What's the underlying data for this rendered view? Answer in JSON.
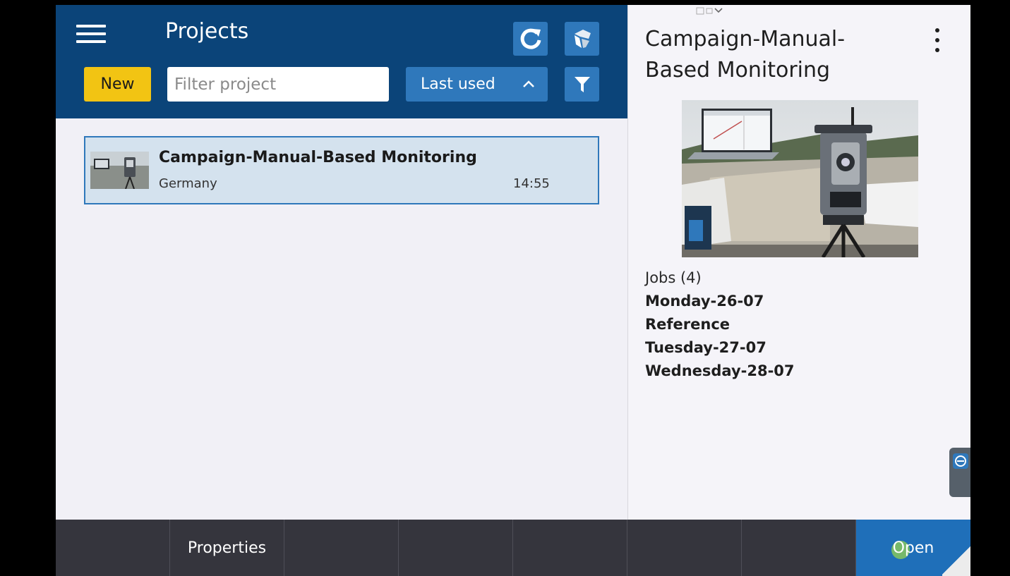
{
  "header": {
    "title": "Projects",
    "new_label": "New",
    "filter_placeholder": "Filter project",
    "sort_label": "Last used"
  },
  "projects": [
    {
      "name": "Campaign-Manual-Based Monitoring",
      "location": "Germany",
      "time": "14:55"
    }
  ],
  "detail": {
    "title": "Campaign-Manual-Based Monitoring",
    "jobs_label": "Jobs (4)",
    "jobs": [
      "Monday-26-07",
      "Reference",
      "Tuesday-27-07",
      "Wednesday-28-07"
    ]
  },
  "bottombar": {
    "properties_label": "Properties",
    "open_label": "Open"
  },
  "colors": {
    "header_bg": "#0b4479",
    "accent_blue": "#2f78bb",
    "new_yellow": "#f2c413",
    "bottombar_bg": "#35353d"
  },
  "icons": [
    "menu-icon",
    "refresh-icon",
    "cloud-sync-icon",
    "chevron-up-icon",
    "funnel-icon",
    "kebab-menu-icon"
  ]
}
